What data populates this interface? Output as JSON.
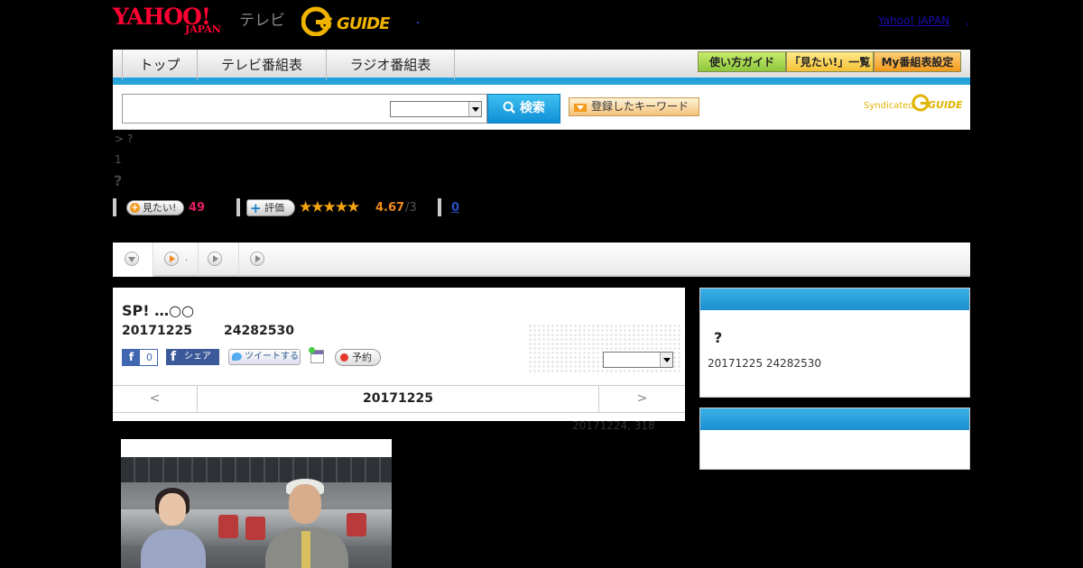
{
  "header": {
    "yahoo_logo": "YAHOO!",
    "yahoo_logo_sub": "JAPAN",
    "tv_label": "テレビ",
    "gguide_logo": "G GUIDE",
    "yahoo_japan_link": "Yahoo! JAPAN",
    "yahoo_japan_link_suffix": ","
  },
  "nav": {
    "tabs": [
      {
        "label": "トップ"
      },
      {
        "label": "テレビ番組表"
      },
      {
        "label": "ラジオ番組表"
      }
    ],
    "guide_button": "使い方ガイド",
    "mitai_list_button": "「見たい!」一覧",
    "my_schedule_button": "My番組表設定"
  },
  "search": {
    "input_value": "",
    "select_value": "",
    "button_label": "検索",
    "keyword_button": "登録したキーワード",
    "syndicated_label": "Syndicated"
  },
  "breadcrumb": "> ?",
  "page_number": "1",
  "page_title": "?",
  "stats": {
    "mitai_label": "見たい!",
    "mitai_count": "49",
    "hyouka_label": "評価",
    "stars": "★★★★★",
    "rating_value": "4.67",
    "rating_denominator": "/3",
    "review_count": "0",
    "rating_fraction": 0.934
  },
  "play_tabs": [
    {
      "label": ""
    },
    {
      "label": "."
    },
    {
      "label": ""
    },
    {
      "label": ""
    }
  ],
  "program": {
    "title": "SP! …○○",
    "date": "20171225",
    "time": "24282530",
    "fb_like_count": "0",
    "fb_share_label": "シェア",
    "tweet_label": "ツイートする",
    "reserve_label": "予約",
    "select_value": "",
    "prev_label": "<",
    "nav_date": "20171225",
    "next_label": ">",
    "updated_text": "20171224, 318"
  },
  "sidebar": {
    "box1_title": "",
    "box1_question": "?",
    "box1_info": "20171225  24282530",
    "box2_title": ""
  },
  "colors": {
    "accent_blue": "#1ea0dc",
    "mitai_count_color": "#e61e64",
    "rating_color": "#f08a1e",
    "star_color": "#f4a50f"
  }
}
